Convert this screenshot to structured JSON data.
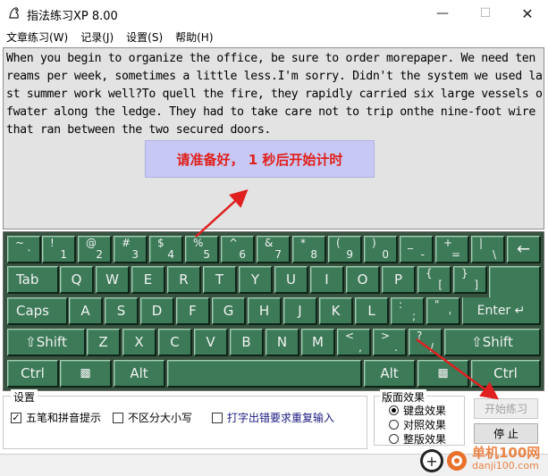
{
  "window": {
    "title": "指法练习XP 8.00",
    "min_icon": "minimize-icon",
    "max_icon": "maximize-icon",
    "close_icon": "close-icon"
  },
  "menu": [
    "文章练习(W)",
    "记录(J)",
    "设置(S)",
    "帮助(H)"
  ],
  "passage": "When you begin to organize the office, be sure to order morepaper. We need ten reams per week, sometimes a little less.I'm sorry. Didn't the system we used last summer work well?To quell the fire, they rapidly carried six large vessels ofwater along the ledge. They had to take care not to trip onthe nine-foot wire that ran between the two secured doors.",
  "countdown": "请准备好， 1 秒后开始计时",
  "keyboard": {
    "row1": [
      {
        "top": "~",
        "bot": "`"
      },
      {
        "top": "!",
        "bot": "1"
      },
      {
        "top": "@",
        "bot": "2"
      },
      {
        "top": "#",
        "bot": "3"
      },
      {
        "top": "$",
        "bot": "4"
      },
      {
        "top": "%",
        "bot": "5"
      },
      {
        "top": "^",
        "bot": "6"
      },
      {
        "top": "&",
        "bot": "7"
      },
      {
        "top": "*",
        "bot": "8"
      },
      {
        "top": "(",
        "bot": "9"
      },
      {
        "top": ")",
        "bot": "0"
      },
      {
        "top": "_",
        "bot": "-"
      },
      {
        "top": "+",
        "bot": "="
      },
      {
        "top": "|",
        "bot": "\\"
      }
    ],
    "backspace": "←",
    "tab": "Tab",
    "row2": [
      "Q",
      "W",
      "E",
      "R",
      "T",
      "Y",
      "U",
      "I",
      "O",
      "P"
    ],
    "row2_sym": [
      {
        "top": "{",
        "bot": "["
      },
      {
        "top": "}",
        "bot": "]"
      }
    ],
    "caps": "Caps",
    "row3": [
      "A",
      "S",
      "D",
      "F",
      "G",
      "H",
      "J",
      "K",
      "L"
    ],
    "row3_sym": [
      {
        "top": ":",
        "bot": ";"
      },
      {
        "top": "\"",
        "bot": "'"
      }
    ],
    "enter": "Enter",
    "lshift": "⇧Shift",
    "row4": [
      "Z",
      "X",
      "C",
      "V",
      "B",
      "N",
      "M"
    ],
    "row4_sym": [
      {
        "top": "<",
        "bot": ","
      },
      {
        "top": ">",
        "bot": "."
      },
      {
        "top": "?",
        "bot": "/"
      }
    ],
    "rshift": "⇧Shift",
    "ctrl": "Ctrl",
    "alt": "Alt",
    "win_icon": "windows-icon"
  },
  "settings": {
    "title": "设置",
    "opt1": "五笔和拼音提示",
    "opt1_checked": true,
    "opt2": "不区分大小写",
    "opt2_checked": false,
    "opt3": "打字出错要求重复输入",
    "opt3_checked": false
  },
  "effects": {
    "title": "版面效果",
    "options": [
      "键盘效果",
      "对照效果",
      "整版效果"
    ],
    "selected": 0
  },
  "buttons": {
    "start": "开始练习",
    "stop": "停 止"
  },
  "watermark": {
    "line1": "单机100网",
    "line2": "danji100.com"
  },
  "colors": {
    "key": "#3c7a58",
    "keyboard_bg": "#37523f",
    "countdown_bg": "#c8c8f5",
    "countdown_text": "#e0201a",
    "arrow": "#e02020"
  }
}
